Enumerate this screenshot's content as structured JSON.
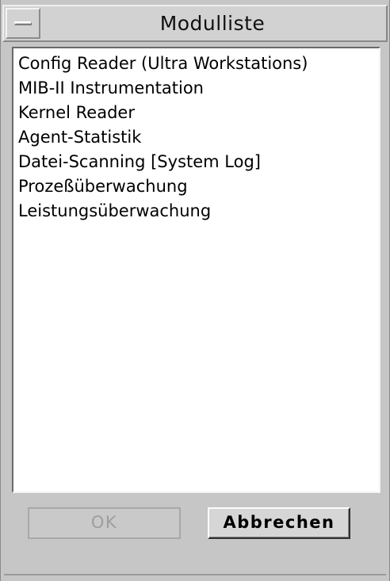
{
  "window": {
    "title": "Modulliste"
  },
  "modules": [
    "Config Reader (Ultra Workstations)",
    "MIB-II Instrumentation",
    "Kernel Reader",
    "Agent-Statistik",
    "Datei-Scanning [System Log]",
    "Prozeßüberwachung",
    "Leistungsüberwachung"
  ],
  "buttons": {
    "ok_label": "OK",
    "cancel_label": "Abbrechen"
  },
  "colors": {
    "window_bg": "#c6c6c6",
    "list_bg": "#ffffff",
    "disabled_text": "#9e9e9e"
  }
}
